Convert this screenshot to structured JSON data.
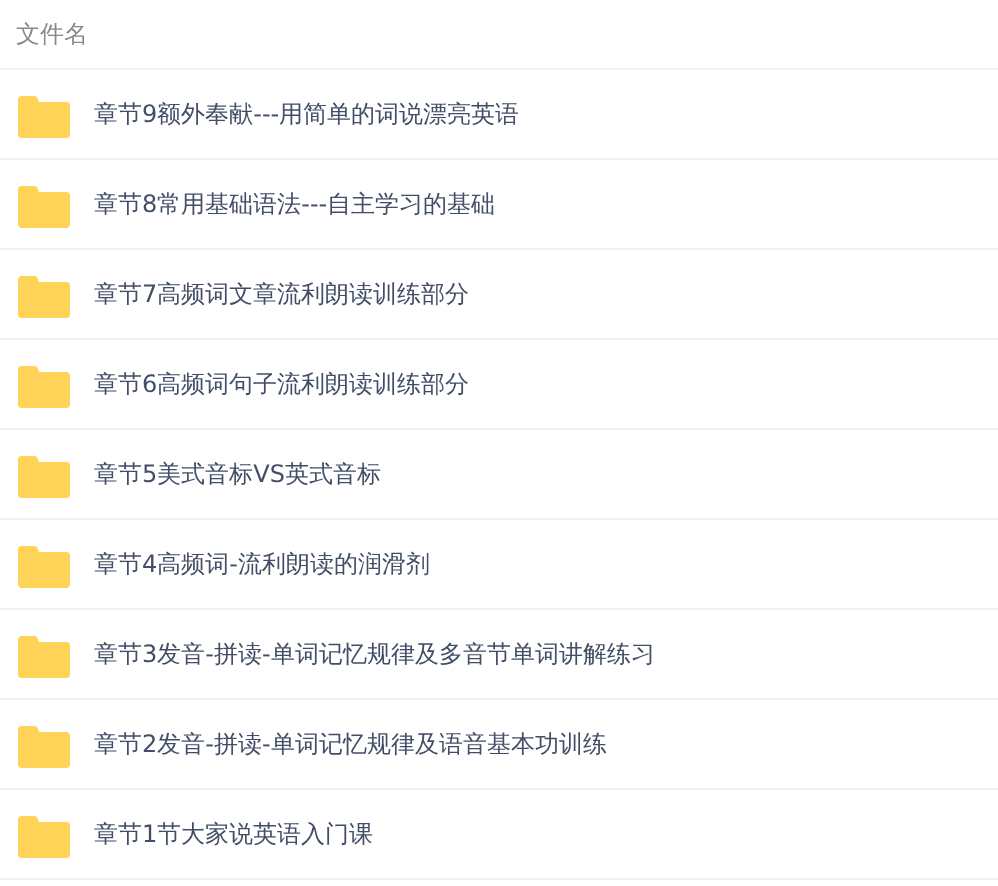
{
  "header": {
    "label": "文件名"
  },
  "files": [
    {
      "name": "章节9额外奉献---用简单的词说漂亮英语"
    },
    {
      "name": "章节8常用基础语法---自主学习的基础"
    },
    {
      "name": "章节7高频词文章流利朗读训练部分"
    },
    {
      "name": "章节6高频词句子流利朗读训练部分"
    },
    {
      "name": "章节5美式音标VS英式音标"
    },
    {
      "name": "章节4高频词-流利朗读的润滑剂"
    },
    {
      "name": "章节3发音-拼读-单词记忆规律及多音节单词讲解练习"
    },
    {
      "name": "章节2发音-拼读-单词记忆规律及语音基本功训练"
    },
    {
      "name": "章节1节大家说英语入门课"
    }
  ]
}
